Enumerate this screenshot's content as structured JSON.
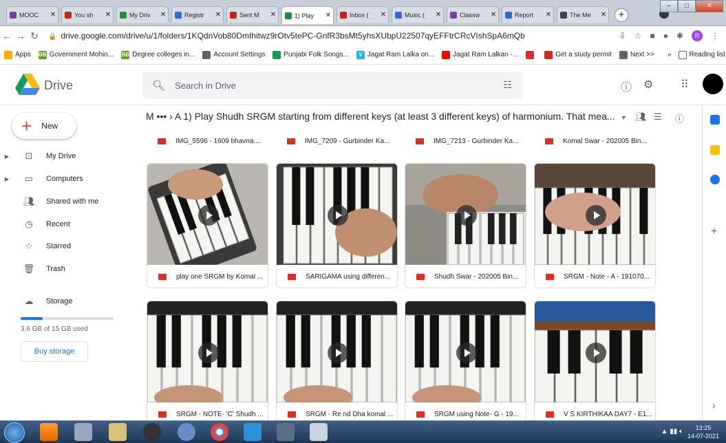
{
  "browser": {
    "tabs": [
      {
        "label": "MOOC",
        "color": "#7b3f9e"
      },
      {
        "label": "You sh",
        "color": "#c5221f"
      },
      {
        "label": "My Driv",
        "color": "#1e8e3e"
      },
      {
        "label": "Registr",
        "color": "#3367d6"
      },
      {
        "label": "Sent M",
        "color": "#c5221f"
      },
      {
        "label": "1) Play",
        "color": "#1e8e3e"
      },
      {
        "label": "Inbox (",
        "color": "#c5221f"
      },
      {
        "label": "Music (",
        "color": "#3367d6"
      },
      {
        "label": "Classw",
        "color": "#7b3f9e"
      },
      {
        "label": "Report",
        "color": "#3367d6"
      },
      {
        "label": "The Me",
        "color": "#444444"
      }
    ],
    "active_tab": 5,
    "url": "drive.google.com/drive/u/1/folders/1KQdnVob80DmIhitwz9rOtv5tePC-GnfR3bsMt5yhsXUbpU22507qyEFFtrCRcVIshSpA6mQb",
    "bookmarks": [
      {
        "label": "Apps",
        "icon": "apps-grid",
        "color": "#f9ab00"
      },
      {
        "label": "Government Mohin...",
        "icon": "BB",
        "color": "#5f9c1c"
      },
      {
        "label": "Degree colleges in...",
        "icon": "BB",
        "color": "#5f9c1c"
      },
      {
        "label": "Account Settings",
        "icon": "globe",
        "color": "#5f6368"
      },
      {
        "label": "Punjabi Folk Songs...",
        "icon": "leaf",
        "color": "#0f9d58"
      },
      {
        "label": "Jagat Ram Lalka on...",
        "icon": "V",
        "color": "#1ab7ea"
      },
      {
        "label": "Jagat Ram Lalkan -...",
        "icon": "play",
        "color": "#ff0000"
      },
      {
        "label": "",
        "icon": "triangle",
        "color": "#d93025"
      },
      {
        "label": "Get a study permit",
        "icon": "maple",
        "color": "#d52b1e"
      },
      {
        "label": "Next >>",
        "icon": "globe",
        "color": "#5f6368"
      }
    ],
    "overflow": "»",
    "reading_list": "Reading list"
  },
  "drive": {
    "logo_text": "Drive",
    "search_placeholder": "Search in Drive",
    "new_label": "New",
    "nav": [
      {
        "label": "My Drive",
        "icon": "my-drive-icon",
        "arrow": true
      },
      {
        "label": "Computers",
        "icon": "computer-icon",
        "arrow": true
      },
      {
        "label": "Shared with me",
        "icon": "people-icon",
        "arrow": false
      },
      {
        "label": "Recent",
        "icon": "clock-icon",
        "arrow": false
      },
      {
        "label": "Starred",
        "icon": "star-icon",
        "arrow": false
      },
      {
        "label": "Trash",
        "icon": "trash-icon",
        "arrow": false
      }
    ],
    "storage_label": "Storage",
    "storage_text": "3.6 GB of 15 GB used",
    "storage_fraction": 0.24,
    "buy_storage": "Buy storage",
    "breadcrumb": "M ••• › A  1) Play Shudh SRGM starting from different keys (at least 3 different keys) of harmonium. That mea...",
    "top_row": [
      "IMG_5596 - 1609 bhavna....",
      "IMG_7209 - Gurbinder Ka...",
      "IMG_7213 - Gurbinder Ka...",
      "Komal Swar - 202005 Bin..."
    ],
    "cards": [
      {
        "name": "play one SRGM by Komal ...",
        "scene": "phone-hand"
      },
      {
        "name": "SARIGAMA using differen...",
        "scene": "phone-keys"
      },
      {
        "name": "Shudh Swar - 202005 Bin...",
        "scene": "mini-keyboard"
      },
      {
        "name": "SRGM - Note - A - 191070...",
        "scene": "harmonium"
      },
      {
        "name": "SRGM - NOTE- 'C' Shudh ...",
        "scene": "piano"
      },
      {
        "name": "SRGM - Re nd Dha komal ...",
        "scene": "piano"
      },
      {
        "name": "SRGM using Note- G - 19...",
        "scene": "piano"
      },
      {
        "name": "V S KIRTHIKAA DAY7 - E1...",
        "scene": "app-piano"
      }
    ]
  },
  "taskbar": {
    "time": "13:25",
    "date": "14-07-2021"
  }
}
